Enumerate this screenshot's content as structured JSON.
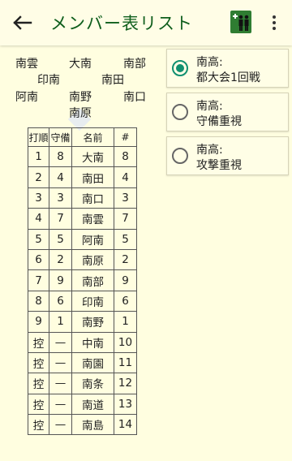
{
  "appbar": {
    "title": "メンバー表リスト",
    "back_icon": "arrow-left",
    "person_icon": "add-people",
    "more_icon": "more-vertical"
  },
  "formation": {
    "cf": "大南",
    "lf": "南雲",
    "rf": "南部",
    "ss": "印南",
    "second": "南田",
    "third": "阿南",
    "pitcher": "南野",
    "first": "南口",
    "catcher": "南原"
  },
  "table": {
    "headers": [
      "打順",
      "守備",
      "名前",
      "#"
    ],
    "rows": [
      [
        "1",
        "8",
        "大南",
        "8"
      ],
      [
        "2",
        "4",
        "南田",
        "4"
      ],
      [
        "3",
        "3",
        "南口",
        "3"
      ],
      [
        "4",
        "7",
        "南雲",
        "7"
      ],
      [
        "5",
        "5",
        "阿南",
        "5"
      ],
      [
        "6",
        "2",
        "南原",
        "2"
      ],
      [
        "7",
        "9",
        "南部",
        "9"
      ],
      [
        "8",
        "6",
        "印南",
        "6"
      ],
      [
        "9",
        "1",
        "南野",
        "1"
      ],
      [
        "控",
        "—",
        "中南",
        "10"
      ],
      [
        "控",
        "—",
        "南園",
        "11"
      ],
      [
        "控",
        "—",
        "南条",
        "12"
      ],
      [
        "控",
        "—",
        "南道",
        "13"
      ],
      [
        "控",
        "—",
        "南島",
        "14"
      ]
    ]
  },
  "options": [
    {
      "line1": "南高:",
      "line2": "都大会1回戦",
      "selected": true
    },
    {
      "line1": "南高:",
      "line2": "守備重視",
      "selected": false
    },
    {
      "line1": "南高:",
      "line2": "攻撃重視",
      "selected": false
    }
  ],
  "colors": {
    "accent": "#109070",
    "title": "#0f5e1c",
    "background": "#fffee0"
  }
}
